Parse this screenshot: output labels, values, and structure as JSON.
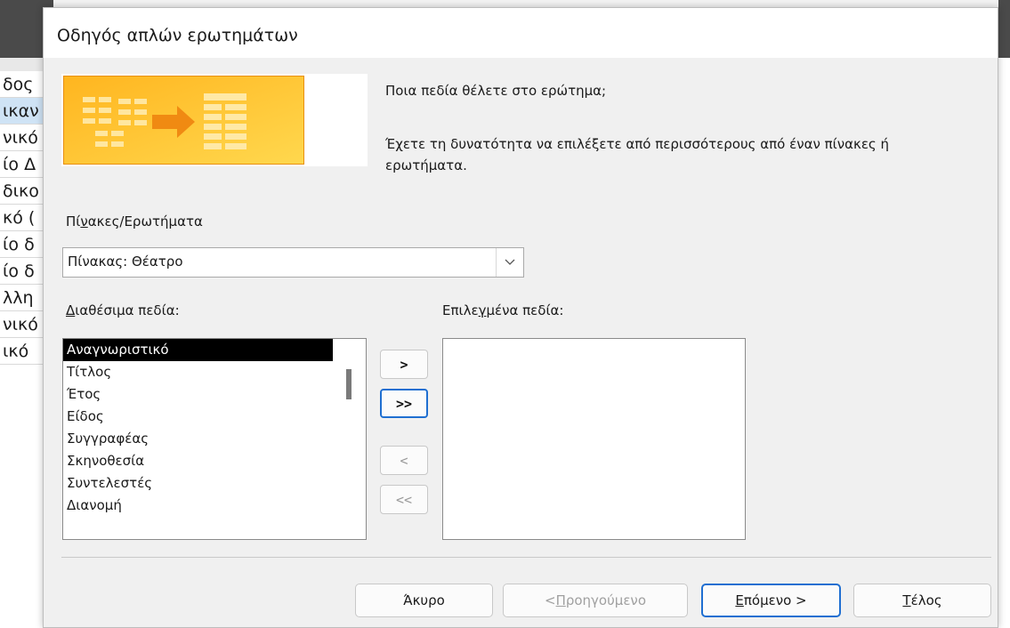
{
  "background_window": {
    "rows": [
      "δος",
      "ικαν",
      "νικό",
      "ίο Δ",
      "δικο",
      "κό (",
      "ίο δ",
      "ίο δ",
      "λλη",
      "νικό",
      "ικό"
    ]
  },
  "dialog": {
    "title": "Οδηγός απλών ερωτημάτων",
    "question": "Ποια πεδία θέλετε στο ερώτημα;",
    "hint": "Έχετε τη δυνατότητα να επιλέξετε από περισσότερους από έναν πίνακες ή ερωτήματα.",
    "tables_label_pre": "Πί",
    "tables_label_ul": "ν",
    "tables_label_post": "ακες/Ερωτήματα",
    "tables_combo": {
      "value": "Πίνακας: Θέατρο",
      "icon": "chevron-down-icon"
    },
    "available_label_ul": "Δ",
    "available_label_post": "ιαθέσιμα πεδία:",
    "selected_label_pre": "Επιλε",
    "selected_label_ul": "γ",
    "selected_label_post": "μένα πεδία:",
    "available_fields": [
      "Αναγνωριστικό",
      "Τίτλος",
      "Έτος",
      "Είδος",
      "Συγγραφέας",
      "Σκηνοθεσία",
      "Συντελεστές",
      "Διανομή"
    ],
    "selected_fields": [],
    "move_buttons": {
      "add_one": ">",
      "add_all": ">>",
      "remove_one": "<",
      "remove_all": "<<"
    },
    "buttons": {
      "cancel": "Άκυρο",
      "back_pre": "< ",
      "back_ul": "Π",
      "back_post": "ροηγούμενο",
      "next_ul": "Ε",
      "next_post": "πόμενο >",
      "finish_ul": "Τ",
      "finish_post": "έλος"
    }
  },
  "colors": {
    "accent": "#1f6fd1",
    "banner_orange": "#f7a21b",
    "banner_yellow": "#ffd24a"
  }
}
